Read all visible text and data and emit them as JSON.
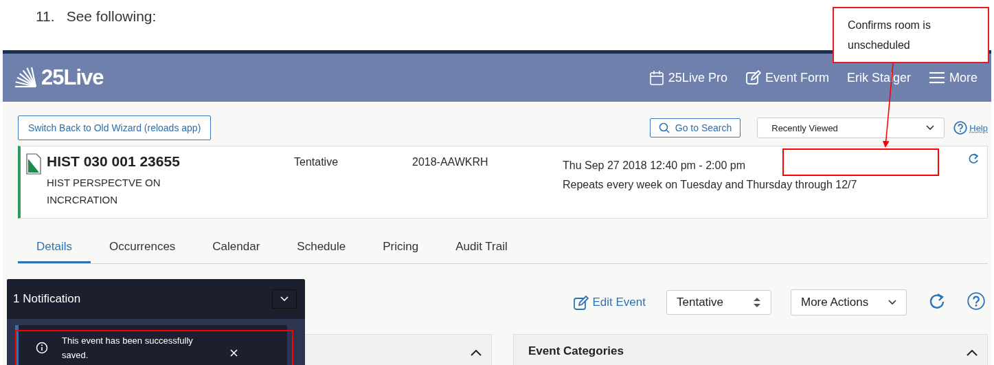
{
  "document": {
    "step_number": "11.",
    "step_text": "See following:"
  },
  "callout": {
    "text": "Confirms room is unscheduled"
  },
  "header": {
    "logo": "25Live",
    "nav": [
      {
        "kind": "pro",
        "label": "25Live Pro"
      },
      {
        "kind": "form",
        "label": "Event Form"
      },
      {
        "kind": "user",
        "label": "Erik Staiger"
      },
      {
        "kind": "menu",
        "label": "More"
      }
    ]
  },
  "toolbar": {
    "switch_button": "Switch Back to Old Wizard (reloads app)",
    "search_button": "Go to Search",
    "recent_select": "Recently Viewed",
    "help_link": "Help"
  },
  "event": {
    "title": "HIST 030 001 23655",
    "name": "HIST PERSPECTVE ON INCRCRATION",
    "state": "Tentative",
    "reference": "2018-AAWKRH",
    "date": "Thu Sep 27 2018 12:40 pm - 2:00 pm",
    "repeat": "Repeats every week on Tuesday and Thursday through 12/7"
  },
  "tabs": [
    {
      "label": "Details",
      "selected": true
    },
    {
      "label": "Occurrences",
      "selected": false
    },
    {
      "label": "Calendar",
      "selected": false
    },
    {
      "label": "Schedule",
      "selected": false
    },
    {
      "label": "Pricing",
      "selected": false
    },
    {
      "label": "Audit Trail",
      "selected": false
    }
  ],
  "actions": {
    "edit": "Edit Event",
    "state_select": "Tentative",
    "more_actions": "More Actions"
  },
  "panels": [
    {
      "kind": "blank"
    },
    {
      "kind": "titled",
      "title": "Event Categories"
    }
  ],
  "notification": {
    "heading": "1 Notification",
    "message": "This event has been successfully saved."
  }
}
